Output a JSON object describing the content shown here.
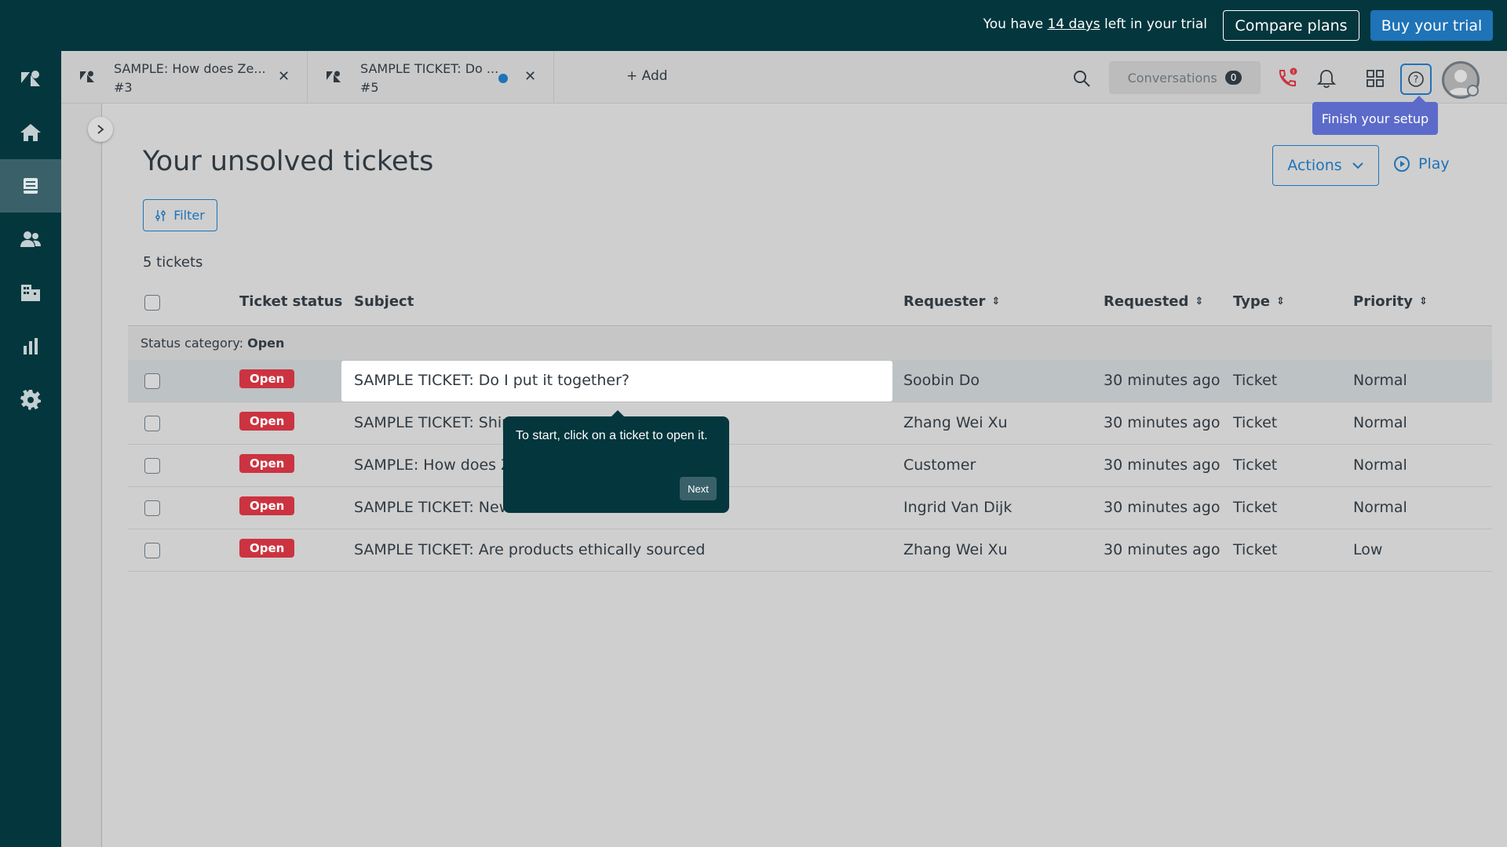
{
  "trial": {
    "prefix": "You have ",
    "days": "14 days",
    "suffix": " left in your trial",
    "compare_label": "Compare plans",
    "buy_label": "Buy your trial"
  },
  "tabs": [
    {
      "title": "SAMPLE: How does Ze...",
      "id": "#3"
    },
    {
      "title": "SAMPLE TICKET: Do ...",
      "id": "#5"
    }
  ],
  "add_tab_label": "Add",
  "header": {
    "conversations_label": "Conversations",
    "conversations_count": "0",
    "setup_tooltip": "Finish your setup"
  },
  "page": {
    "title": "Your unsolved tickets",
    "actions_label": "Actions",
    "play_label": "Play",
    "filter_label": "Filter",
    "ticket_count": "5 tickets"
  },
  "table": {
    "columns": {
      "status": "Ticket status",
      "subject": "Subject",
      "requester": "Requester",
      "requested": "Requested",
      "type": "Type",
      "priority": "Priority"
    },
    "group_label": "Status category: ",
    "group_value": "Open",
    "rows": [
      {
        "status": "Open",
        "subject": "SAMPLE TICKET: Do I put it together?",
        "requester": "Soobin Do",
        "requested": "30 minutes ago",
        "type": "Ticket",
        "priority": "Normal"
      },
      {
        "status": "Open",
        "subject": "SAMPLE TICKET: Shipp",
        "requester": "Zhang Wei Xu",
        "requested": "30 minutes ago",
        "type": "Ticket",
        "priority": "Normal"
      },
      {
        "status": "Open",
        "subject": "SAMPLE: How does Ze",
        "requester": "Customer",
        "requested": "30 minutes ago",
        "type": "Ticket",
        "priority": "Normal"
      },
      {
        "status": "Open",
        "subject": "SAMPLE TICKET: New c",
        "requester": "Ingrid Van Dijk",
        "requested": "30 minutes ago",
        "type": "Ticket",
        "priority": "Normal"
      },
      {
        "status": "Open",
        "subject": "SAMPLE TICKET: Are products ethically sourced",
        "requester": "Zhang Wei Xu",
        "requested": "30 minutes ago",
        "type": "Ticket",
        "priority": "Low"
      }
    ]
  },
  "tour": {
    "text": "To start, click on a ticket to open it.",
    "next_label": "Next"
  },
  "colors": {
    "brand_dark": "#03363d",
    "accent_blue": "#1f73b7",
    "status_open": "#cc3340",
    "setup_tip": "#5c6bc9"
  },
  "icons": {
    "nav": [
      "zendesk-logo-icon",
      "home-icon",
      "views-icon",
      "customers-icon",
      "organizations-icon",
      "reporting-icon",
      "admin-gear-icon"
    ],
    "header": [
      "search-icon",
      "phone-icon",
      "bell-icon",
      "apps-grid-icon",
      "help-icon",
      "avatar"
    ]
  }
}
